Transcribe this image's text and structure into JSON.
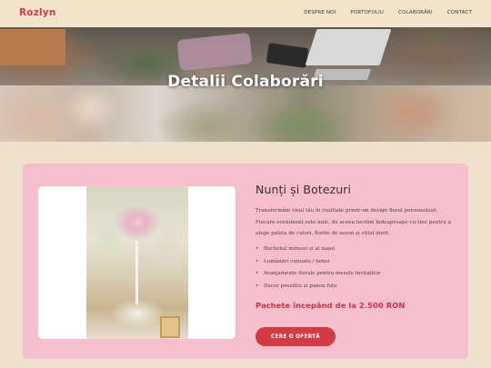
{
  "nav": {
    "logo": "Rozlyn",
    "links": [
      "DESPRE NOI",
      "PORTOFOLIU",
      "COLABORĂRI",
      "CONTACT"
    ]
  },
  "hero": {
    "title": "Detalii Colaborări"
  },
  "card": {
    "title": "Nunți și Botezuri",
    "description": "Transformăm visul tău în realitate printr-un design floral personalizat. Fiecare eveniment este unic, de aceea lucrăm îndeaproape cu tine pentru a alege paleta de culori, florile de sezon și stilul dorit.",
    "features": [
      "Buchetul miresei și al nașei",
      "Lumânări cununie / botez",
      "Aranjamente florale pentru mesele invitaților",
      "Decor prezidiu și panou foto"
    ],
    "price": "Pachete începând de la 2.500 RON",
    "cta": "CERE O OFERTĂ"
  },
  "colors": {
    "background": "#efe1cb",
    "accent": "#d43a42",
    "card": "#f5bfcd",
    "price": "#cf3049"
  }
}
